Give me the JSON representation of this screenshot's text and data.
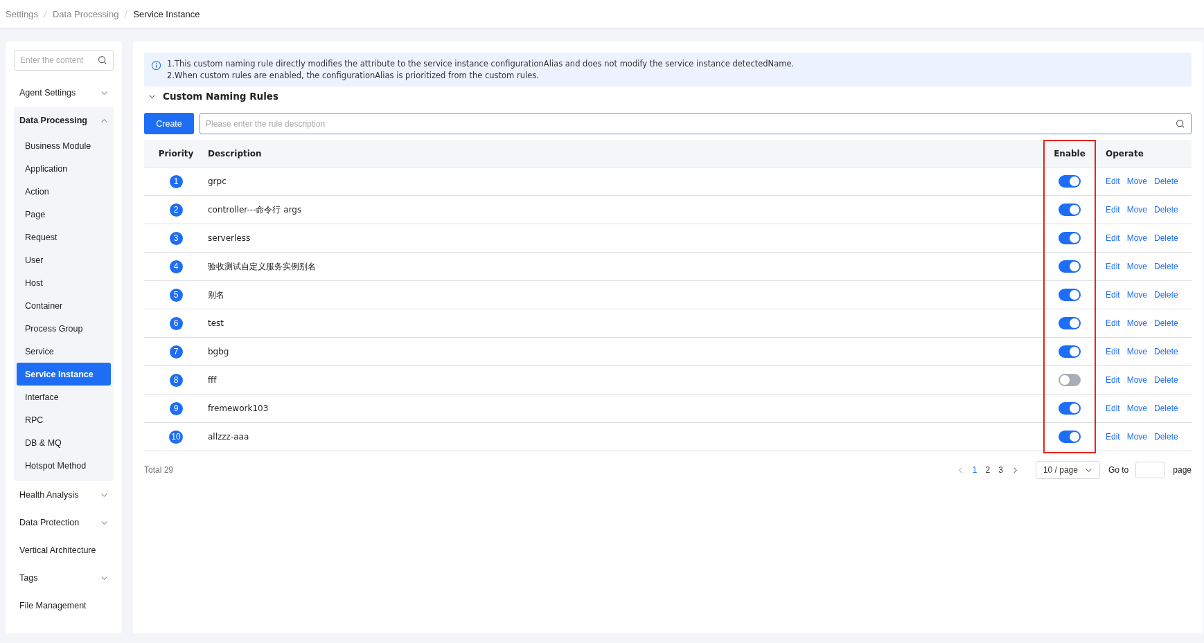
{
  "breadcrumb": [
    "Settings",
    "Data Processing",
    "Service Instance"
  ],
  "sidebar": {
    "search": {
      "placeholder": "Enter the content"
    },
    "items": [
      {
        "label": "Agent Settings",
        "kind": "group",
        "expanded": false,
        "selected": false
      },
      {
        "label": "Data Processing",
        "kind": "group",
        "expanded": true,
        "selected": false,
        "children": [
          {
            "label": "Business Module",
            "selected": false
          },
          {
            "label": "Application",
            "selected": false
          },
          {
            "label": "Action",
            "selected": false
          },
          {
            "label": "Page",
            "selected": false
          },
          {
            "label": "Request",
            "selected": false
          },
          {
            "label": "User",
            "selected": false
          },
          {
            "label": "Host",
            "selected": false
          },
          {
            "label": "Container",
            "selected": false
          },
          {
            "label": "Process Group",
            "selected": false
          },
          {
            "label": "Service",
            "selected": false
          },
          {
            "label": "Service Instance",
            "selected": true
          },
          {
            "label": "Interface",
            "selected": false
          },
          {
            "label": "RPC",
            "selected": false
          },
          {
            "label": "DB & MQ",
            "selected": false
          },
          {
            "label": "Hotspot Method",
            "selected": false
          }
        ]
      },
      {
        "label": "Health Analysis",
        "kind": "group",
        "expanded": false,
        "selected": false
      },
      {
        "label": "Data Protection",
        "kind": "group",
        "expanded": false,
        "selected": false
      },
      {
        "label": "Vertical Architecture",
        "kind": "link",
        "selected": false
      },
      {
        "label": "Tags",
        "kind": "group",
        "expanded": false,
        "selected": false
      },
      {
        "label": "File Management",
        "kind": "link",
        "selected": false
      }
    ]
  },
  "notice": [
    "1.This custom naming rule directly modifies the attribute to the service instance configurationAlias and does not modify the service instance detectedName.",
    "2.When custom rules are enabled, the configurationAlias is prioritized from the custom rules."
  ],
  "section": {
    "title": "Custom Naming Rules",
    "expanded": true
  },
  "create_button": "Create",
  "rule_search": {
    "placeholder": "Please enter the rule description"
  },
  "table": {
    "columns": [
      {
        "label": "Priority",
        "highlighted": false
      },
      {
        "label": "Description",
        "highlighted": false
      },
      {
        "label": "Enable",
        "highlighted": true
      },
      {
        "label": "Operate",
        "highlighted": false
      }
    ],
    "rows": [
      {
        "priority": "1",
        "description": "grpc",
        "enabled": true,
        "actions": [
          "Edit",
          "Move",
          "Delete"
        ]
      },
      {
        "priority": "2",
        "description": "controller---命令行 args",
        "enabled": true,
        "actions": [
          "Edit",
          "Move",
          "Delete"
        ]
      },
      {
        "priority": "3",
        "description": "serverless",
        "enabled": true,
        "actions": [
          "Edit",
          "Move",
          "Delete"
        ]
      },
      {
        "priority": "4",
        "description": "验收测试自定义服务实例别名",
        "enabled": true,
        "actions": [
          "Edit",
          "Move",
          "Delete"
        ]
      },
      {
        "priority": "5",
        "description": "别名",
        "enabled": true,
        "actions": [
          "Edit",
          "Move",
          "Delete"
        ]
      },
      {
        "priority": "6",
        "description": "test",
        "enabled": true,
        "actions": [
          "Edit",
          "Move",
          "Delete"
        ]
      },
      {
        "priority": "7",
        "description": "bgbg",
        "enabled": true,
        "actions": [
          "Edit",
          "Move",
          "Delete"
        ]
      },
      {
        "priority": "8",
        "description": "fff",
        "enabled": false,
        "actions": [
          "Edit",
          "Move",
          "Delete"
        ]
      },
      {
        "priority": "9",
        "description": "fremework103",
        "enabled": true,
        "actions": [
          "Edit",
          "Move",
          "Delete"
        ]
      },
      {
        "priority": "10",
        "description": "allzzz-aaa",
        "enabled": true,
        "actions": [
          "Edit",
          "Move",
          "Delete"
        ]
      }
    ]
  },
  "pagination": {
    "total": "Total 29",
    "pages": [
      {
        "label": "1",
        "selected": true
      },
      {
        "label": "2",
        "selected": false
      },
      {
        "label": "3",
        "selected": false
      }
    ],
    "page_size": "10 / page",
    "goto_label": "Go to",
    "goto_suffix": "page"
  }
}
